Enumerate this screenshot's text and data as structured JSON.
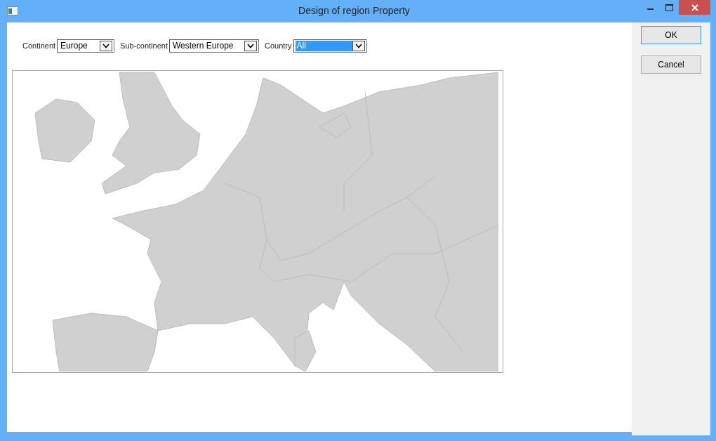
{
  "window": {
    "title": "Design of region Property"
  },
  "filters": [
    {
      "label": "Continent",
      "value": "Europe",
      "highlighted": false
    },
    {
      "label": "Sub-continent",
      "value": "Western Europe",
      "highlighted": false
    },
    {
      "label": "Country",
      "value": "All",
      "highlighted": true
    }
  ],
  "buttons": [
    {
      "label": "OK",
      "default": true
    },
    {
      "label": "Cancel",
      "default": false
    }
  ]
}
